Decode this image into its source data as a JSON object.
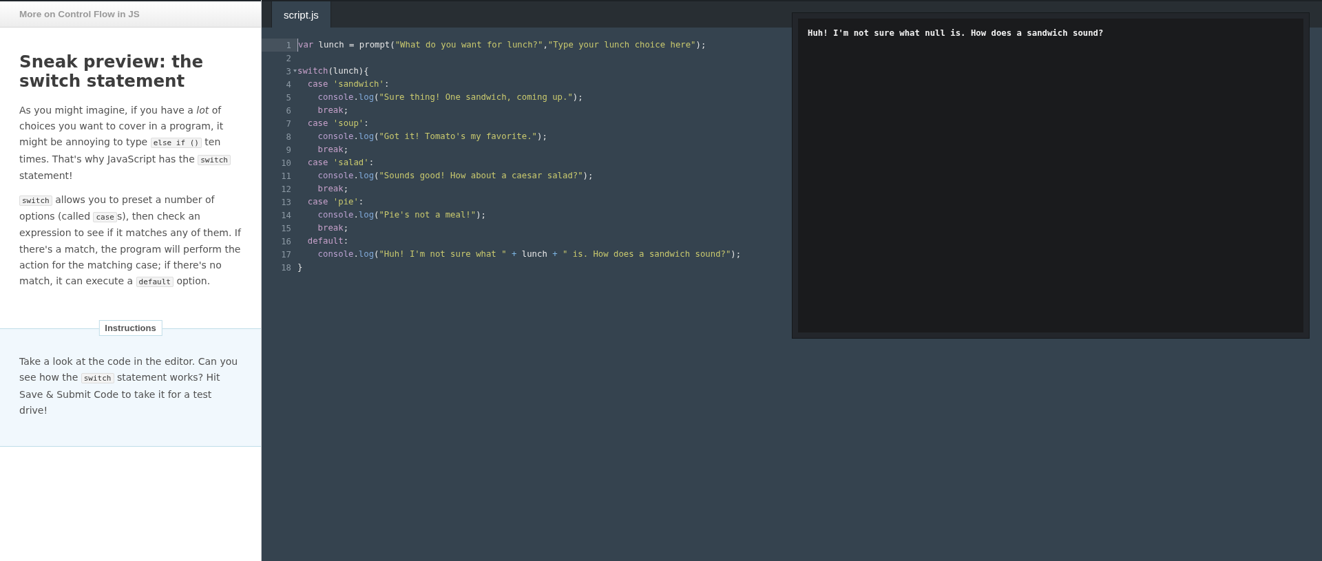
{
  "lesson": {
    "course_title": "More on Control Flow in JS",
    "heading": "Sneak preview: the switch statement",
    "paragraphs": [
      [
        {
          "kind": "text",
          "text": "As you might imagine, if you have a *lot* of choices you want to cover in a program, it might be annoying to type "
        },
        {
          "kind": "code",
          "text": "else if ()"
        },
        {
          "kind": "text",
          "text": " ten times. That's why JavaScript has the "
        },
        {
          "kind": "code",
          "text": "switch"
        },
        {
          "kind": "text",
          "text": " statement!"
        }
      ],
      [
        {
          "kind": "code",
          "text": "switch"
        },
        {
          "kind": "text",
          "text": " allows you to preset a number of options (called "
        },
        {
          "kind": "code",
          "text": "case"
        },
        {
          "kind": "text",
          "text": "s), then check an expression to see if it matches any of them. If there's a match, the program will perform the action for the matching case; if there's no match, it can execute a "
        },
        {
          "kind": "code",
          "text": "default"
        },
        {
          "kind": "text",
          "text": " option."
        }
      ]
    ],
    "instructions": {
      "label": "Instructions",
      "text": [
        {
          "kind": "text",
          "text": "Take a look at the code in the editor. Can you see how the "
        },
        {
          "kind": "code",
          "text": "switch"
        },
        {
          "kind": "text",
          "text": " statement works? Hit Save & Submit Code to take it for a test drive!"
        }
      ]
    }
  },
  "editor": {
    "tabs": [
      {
        "label": "script.js",
        "selected": true
      }
    ],
    "lines": [
      {
        "number": "1",
        "active": true,
        "foldable": false,
        "tokens": [
          {
            "kind": "keyword",
            "text": "var"
          },
          {
            "kind": "plain",
            "text": " lunch = prompt("
          },
          {
            "kind": "string",
            "text": "\"What do you want for lunch?\""
          },
          {
            "kind": "plain",
            "text": ","
          },
          {
            "kind": "string",
            "text": "\"Type your lunch choice here\""
          },
          {
            "kind": "plain",
            "text": ");"
          }
        ]
      },
      {
        "number": "2",
        "active": false,
        "foldable": false
      },
      {
        "number": "3",
        "active": false,
        "foldable": true,
        "tokens": [
          {
            "kind": "keyword",
            "text": "switch"
          },
          {
            "kind": "plain",
            "text": "(lunch){"
          }
        ]
      },
      {
        "number": "4",
        "active": false,
        "foldable": false,
        "tokens": [
          {
            "kind": "keyword",
            "text": "  case "
          },
          {
            "kind": "string",
            "text": "'sandwich'"
          },
          {
            "kind": "plain",
            "text": ":"
          }
        ]
      },
      {
        "number": "5",
        "active": false,
        "foldable": false,
        "tokens": [
          {
            "kind": "object",
            "text": "    console"
          },
          {
            "kind": "plain",
            "text": "."
          },
          {
            "kind": "method",
            "text": "log"
          },
          {
            "kind": "plain",
            "text": "("
          },
          {
            "kind": "string",
            "text": "\"Sure thing! One sandwich, coming up.\""
          },
          {
            "kind": "plain",
            "text": ");"
          }
        ]
      },
      {
        "number": "6",
        "active": false,
        "foldable": false,
        "tokens": [
          {
            "kind": "keyword",
            "text": "    break"
          },
          {
            "kind": "plain",
            "text": ";"
          }
        ]
      },
      {
        "number": "7",
        "active": false,
        "foldable": false,
        "tokens": [
          {
            "kind": "keyword",
            "text": "  case "
          },
          {
            "kind": "string",
            "text": "'soup'"
          },
          {
            "kind": "plain",
            "text": ":"
          }
        ]
      },
      {
        "number": "8",
        "active": false,
        "foldable": false,
        "tokens": [
          {
            "kind": "object",
            "text": "    console"
          },
          {
            "kind": "plain",
            "text": "."
          },
          {
            "kind": "method",
            "text": "log"
          },
          {
            "kind": "plain",
            "text": "("
          },
          {
            "kind": "string",
            "text": "\"Got it! Tomato's my favorite.\""
          },
          {
            "kind": "plain",
            "text": ");"
          }
        ]
      },
      {
        "number": "9",
        "active": false,
        "foldable": false,
        "tokens": [
          {
            "kind": "keyword",
            "text": "    break"
          },
          {
            "kind": "plain",
            "text": ";"
          }
        ]
      },
      {
        "number": "10",
        "active": false,
        "foldable": false,
        "tokens": [
          {
            "kind": "keyword",
            "text": "  case "
          },
          {
            "kind": "string",
            "text": "'salad'"
          },
          {
            "kind": "plain",
            "text": ":"
          }
        ]
      },
      {
        "number": "11",
        "active": false,
        "foldable": false,
        "tokens": [
          {
            "kind": "object",
            "text": "    console"
          },
          {
            "kind": "plain",
            "text": "."
          },
          {
            "kind": "method",
            "text": "log"
          },
          {
            "kind": "plain",
            "text": "("
          },
          {
            "kind": "string",
            "text": "\"Sounds good! How about a caesar salad?\""
          },
          {
            "kind": "plain",
            "text": ");"
          }
        ]
      },
      {
        "number": "12",
        "active": false,
        "foldable": false,
        "tokens": [
          {
            "kind": "keyword",
            "text": "    break"
          },
          {
            "kind": "plain",
            "text": ";"
          }
        ]
      },
      {
        "number": "13",
        "active": false,
        "foldable": false,
        "tokens": [
          {
            "kind": "keyword",
            "text": "  case "
          },
          {
            "kind": "string",
            "text": "'pie'"
          },
          {
            "kind": "plain",
            "text": ":"
          }
        ]
      },
      {
        "number": "14",
        "active": false,
        "foldable": false,
        "tokens": [
          {
            "kind": "object",
            "text": "    console"
          },
          {
            "kind": "plain",
            "text": "."
          },
          {
            "kind": "method",
            "text": "log"
          },
          {
            "kind": "plain",
            "text": "("
          },
          {
            "kind": "string",
            "text": "\"Pie's not a meal!\""
          },
          {
            "kind": "plain",
            "text": ");"
          }
        ]
      },
      {
        "number": "15",
        "active": false,
        "foldable": false,
        "tokens": [
          {
            "kind": "keyword",
            "text": "    break"
          },
          {
            "kind": "plain",
            "text": ";"
          }
        ]
      },
      {
        "number": "16",
        "active": false,
        "foldable": false,
        "tokens": [
          {
            "kind": "keyword",
            "text": "  default"
          },
          {
            "kind": "plain",
            "text": ":"
          }
        ]
      },
      {
        "number": "17",
        "active": false,
        "foldable": false,
        "tokens": [
          {
            "kind": "object",
            "text": "    console"
          },
          {
            "kind": "plain",
            "text": "."
          },
          {
            "kind": "method",
            "text": "log"
          },
          {
            "kind": "plain",
            "text": "("
          },
          {
            "kind": "string",
            "text": "\"Huh! I'm not sure what \""
          },
          {
            "kind": "operator",
            "text": " + "
          },
          {
            "kind": "plain",
            "text": "lunch"
          },
          {
            "kind": "operator",
            "text": " + "
          },
          {
            "kind": "string",
            "text": "\" is. How does a sandwich sound?\""
          },
          {
            "kind": "plain",
            "text": ");"
          }
        ]
      },
      {
        "number": "18",
        "active": false,
        "foldable": false,
        "tokens": [
          {
            "kind": "plain",
            "text": "}"
          }
        ]
      }
    ]
  },
  "console": {
    "output": [
      "Huh! I'm not sure what null is. How does a sandwich sound?"
    ]
  }
}
